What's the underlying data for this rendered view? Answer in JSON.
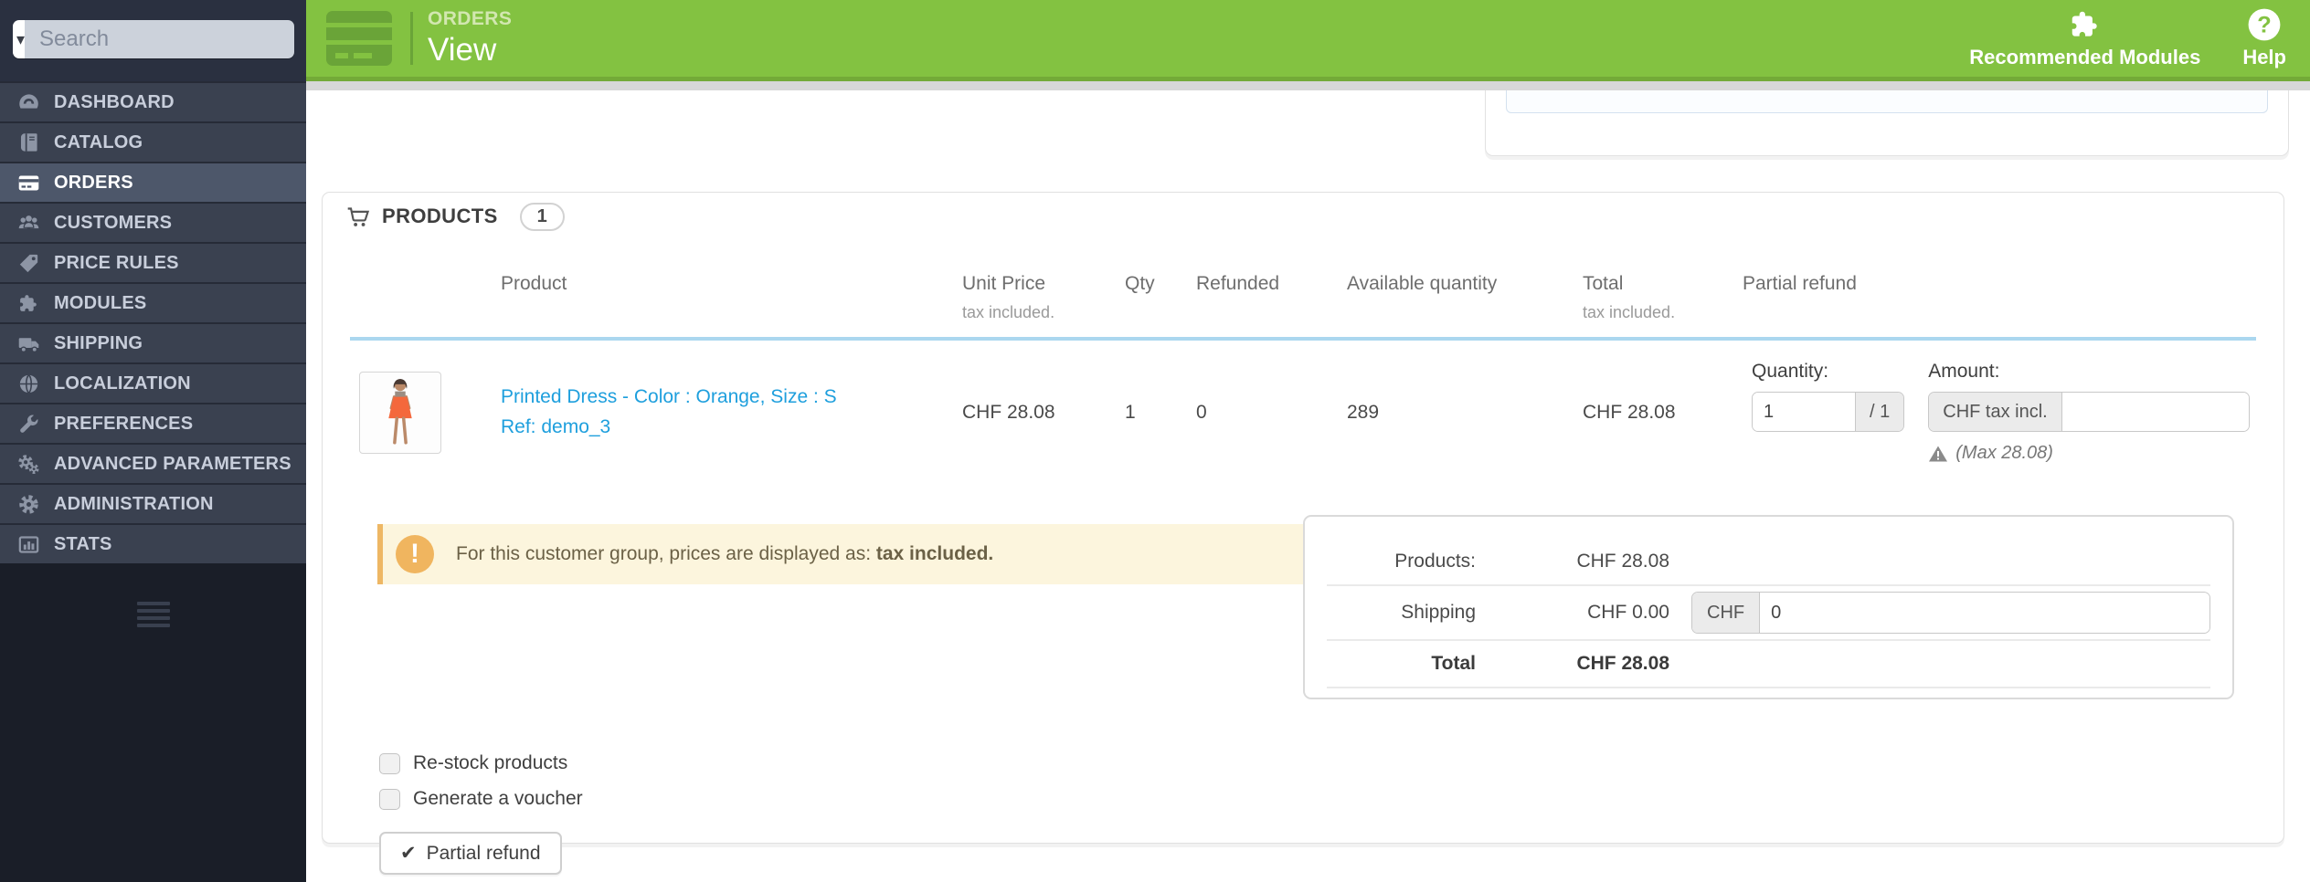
{
  "search": {
    "placeholder": "Search"
  },
  "sidebar": {
    "items": [
      {
        "label": "DASHBOARD"
      },
      {
        "label": "CATALOG"
      },
      {
        "label": "ORDERS"
      },
      {
        "label": "CUSTOMERS"
      },
      {
        "label": "PRICE RULES"
      },
      {
        "label": "MODULES"
      },
      {
        "label": "SHIPPING"
      },
      {
        "label": "LOCALIZATION"
      },
      {
        "label": "PREFERENCES"
      },
      {
        "label": "ADVANCED PARAMETERS"
      },
      {
        "label": "ADMINISTRATION"
      },
      {
        "label": "STATS"
      }
    ]
  },
  "header": {
    "breadcrumb": "ORDERS",
    "title": "View",
    "actions": {
      "recommended_modules": "Recommended Modules",
      "help": "Help"
    }
  },
  "products_panel": {
    "title": "PRODUCTS",
    "count": "1",
    "table": {
      "headers": {
        "product": "Product",
        "unit_price": "Unit Price",
        "unit_price_note": "tax included.",
        "qty": "Qty",
        "refunded": "Refunded",
        "available_quantity": "Available quantity",
        "total": "Total",
        "total_note": "tax included.",
        "partial_refund": "Partial refund"
      },
      "row": {
        "product_name": "Printed Dress - Color : Orange, Size : S",
        "product_ref": "Ref: demo_3",
        "unit_price": "CHF 28.08",
        "qty": "1",
        "refunded": "0",
        "available_quantity": "289",
        "total": "CHF 28.08",
        "partial_refund": {
          "quantity_label": "Quantity:",
          "quantity_value": "1",
          "quantity_max": "/ 1",
          "amount_label": "Amount:",
          "amount_addon": "CHF tax incl.",
          "max_note": "(Max 28.08)"
        }
      }
    },
    "warning": {
      "text": "For this customer group, prices are displayed as: ",
      "bold": "tax included."
    },
    "totals": {
      "products_label": "Products:",
      "products_value": "CHF 28.08",
      "shipping_label": "Shipping",
      "shipping_value": "CHF 0.00",
      "shipping_addon": "CHF",
      "shipping_input": "0",
      "total_label": "Total",
      "total_value": "CHF 28.08"
    },
    "options": [
      {
        "label": "Re-stock products"
      },
      {
        "label": "Generate a voucher"
      }
    ],
    "submit_label": "Partial refund"
  },
  "icons": {
    "search_caret": "▾",
    "check": "✔",
    "warning_mark": "!"
  },
  "colors": {
    "green": "#83c241",
    "green-dark": "#73aa38",
    "link": "#1e9fdd",
    "table-blue": "#abd7ef",
    "warn-accent": "#eeb764",
    "side-active": "#4d576a"
  }
}
